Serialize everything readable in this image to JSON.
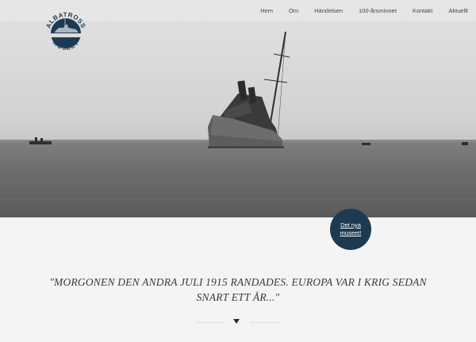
{
  "logo": {
    "text_top": "ALBATROSS",
    "text_bottom": "MUSEET"
  },
  "nav": {
    "items": [
      {
        "label": "Hem"
      },
      {
        "label": "Om"
      },
      {
        "label": "Händelsen"
      },
      {
        "label": "100-årsminnet"
      },
      {
        "label": "Kontakt"
      },
      {
        "label": "Aktuellt"
      }
    ]
  },
  "badge": {
    "line1": "Det nya",
    "line2": "museet!"
  },
  "quote": {
    "line1": "\"MORGONEN DEN ANDRA JULI 1915 RANDADES. EUROPA VAR I KRIG SEDAN",
    "line2": "SNART ETT ÅR...\""
  },
  "colors": {
    "badge_bg": "#1d3a52",
    "nav_text": "#3d4a56",
    "quote_text": "#3e3a36",
    "background": "#f4f4f4"
  },
  "icons": {
    "scroll": "chevron-down-icon"
  }
}
